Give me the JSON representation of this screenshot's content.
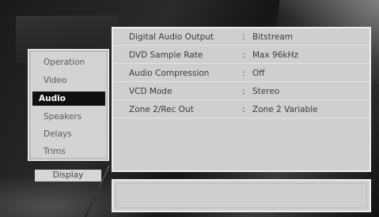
{
  "sidebar": {
    "items": [
      {
        "label": "Operation",
        "selected": false
      },
      {
        "label": "Video",
        "selected": false
      },
      {
        "label": "Audio",
        "selected": true
      },
      {
        "label": "Speakers",
        "selected": false
      },
      {
        "label": "Delays",
        "selected": false
      },
      {
        "label": "Trims",
        "selected": false
      }
    ]
  },
  "display_button": {
    "label": "Display"
  },
  "settings": {
    "rows": [
      {
        "name": "Digital Audio Output",
        "colon": ":",
        "value": "Bitstream"
      },
      {
        "name": "DVD Sample Rate",
        "colon": ":",
        "value": "Max 96kHz"
      },
      {
        "name": "Audio Compression",
        "colon": ":",
        "value": "Off"
      },
      {
        "name": "VCD Mode",
        "colon": ":",
        "value": "Stereo"
      },
      {
        "name": "Zone 2/Rec Out",
        "colon": ":",
        "value": "Zone 2 Variable"
      }
    ]
  },
  "status_bar": {
    "text": ""
  },
  "colors": {
    "panel": "#cfcfcf",
    "selected_bg": "#101010",
    "selected_text": "#ffffff",
    "text": "#3a3a3a"
  }
}
